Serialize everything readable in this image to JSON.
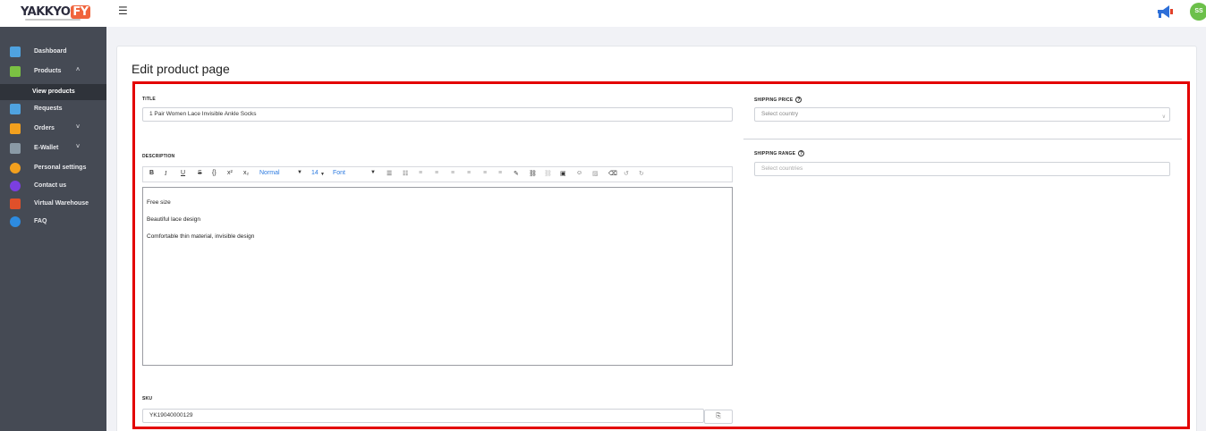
{
  "brand": {
    "logo_main": "YAKKYO",
    "logo_suffix": "FY",
    "accent": "#f0643c"
  },
  "header": {
    "menu_icon": "hamburger-icon",
    "notification_icon": "megaphone-icon",
    "avatar_initials": "SS"
  },
  "sidebar": {
    "items": [
      {
        "label": "Dashboard",
        "icon": "dashboard-icon",
        "color": "#4fa3e0"
      },
      {
        "label": "Products",
        "icon": "products-icon",
        "color": "#7bc143",
        "chevron": "˄"
      },
      {
        "label": "Requests",
        "icon": "requests-icon",
        "color": "#4fa3e0"
      },
      {
        "label": "Orders",
        "icon": "orders-icon",
        "color": "#f2a01e",
        "chevron": "˅"
      },
      {
        "label": "E-Wallet",
        "icon": "wallet-icon",
        "color": "#8a9aa6",
        "chevron": "˅"
      },
      {
        "label": "Personal settings",
        "icon": "gears-icon",
        "color": "#f2a01e"
      },
      {
        "label": "Contact us",
        "icon": "contact-icon",
        "color": "#7b3fe0"
      },
      {
        "label": "Virtual Warehouse",
        "icon": "warehouse-icon",
        "color": "#e0502a"
      },
      {
        "label": "FAQ",
        "icon": "info-icon",
        "color": "#2d8be0"
      }
    ],
    "active_sub": "View products"
  },
  "page": {
    "title": "Edit product page"
  },
  "form": {
    "title_label": "TITLE",
    "title_value": "1 Pair Women Lace Invisible Ankle Socks",
    "description_label": "DESCRIPTION",
    "toolbar": {
      "bold": "B",
      "italic": "I",
      "underline": "U",
      "strike": "S",
      "code": "{}",
      "superscript": "x²",
      "subscript": "x₂",
      "block_type": "Normal",
      "font_size": "14",
      "font_family": "Font"
    },
    "description_lines": [
      "Free size",
      "Beautiful lace design",
      "Comfortable thin material, invisible design"
    ],
    "sku_label": "SKU",
    "sku_value": "YK19040000129",
    "shipping_price_label": "SHIPPING PRICE",
    "shipping_price_placeholder": "Select country",
    "shipping_range_label": "SHIPPING RANGE",
    "shipping_range_placeholder": "Select countries",
    "help_glyph": "?"
  }
}
